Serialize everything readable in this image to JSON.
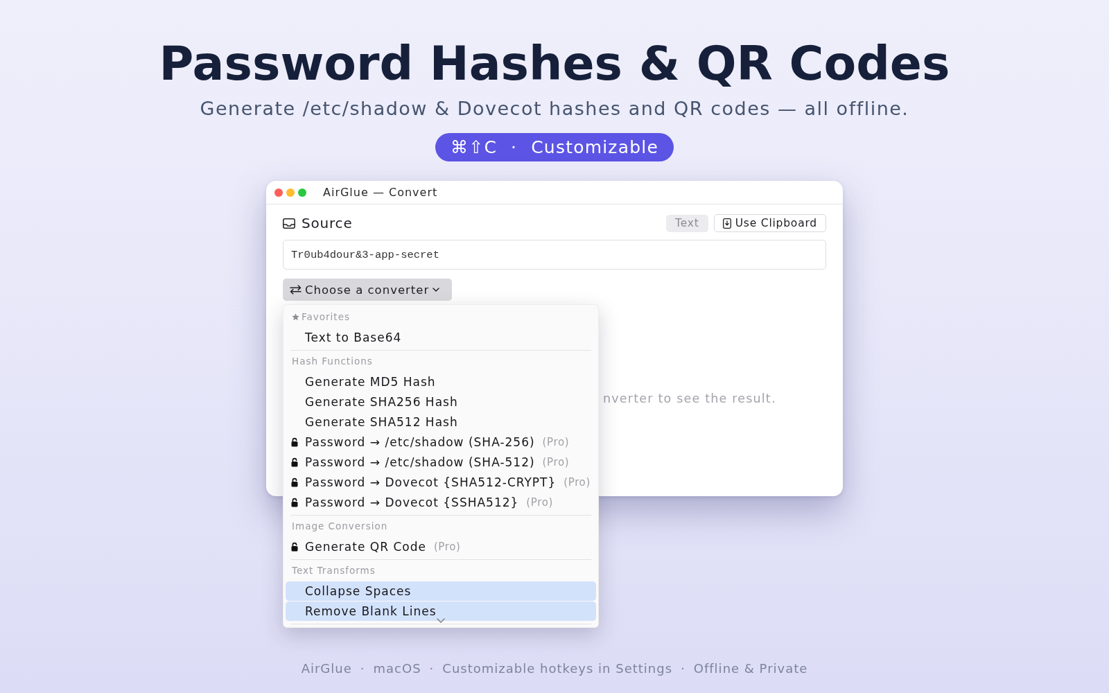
{
  "hero": {
    "title": "Password Hashes & QR Codes",
    "subtitle": "Generate /etc/shadow & Dovecot hashes and QR codes — all offline.",
    "badge": {
      "keys": "⌘⇧C",
      "separator": "·",
      "label": "Customizable"
    }
  },
  "window": {
    "title": "AirGlue — Convert"
  },
  "source": {
    "title": "Source",
    "type_tag": "Text",
    "clipboard_button": "Use Clipboard",
    "input_value": "Tr0ub4dour&3-app-secret"
  },
  "converter_button": {
    "label": "Choose a converter",
    "expanded": true
  },
  "empty_result_message": "nverter to see the result.",
  "menu": {
    "more_below": true,
    "sections": [
      {
        "kind": "favorites",
        "title": "Favorites",
        "items": [
          {
            "label": "Text to Base64",
            "locked": false,
            "selected": false
          }
        ]
      },
      {
        "kind": "plain",
        "title": "Hash Functions",
        "items": [
          {
            "label": "Generate MD5 Hash",
            "locked": false,
            "selected": false
          },
          {
            "label": "Generate SHA256 Hash",
            "locked": false,
            "selected": false
          },
          {
            "label": "Generate SHA512 Hash",
            "locked": false,
            "selected": false
          },
          {
            "label": "Password → /etc/shadow (SHA-256)",
            "locked": true,
            "badge": "(Pro)",
            "selected": false
          },
          {
            "label": "Password → /etc/shadow (SHA-512)",
            "locked": true,
            "badge": "(Pro)",
            "selected": false
          },
          {
            "label": "Password → Dovecot {SHA512-CRYPT}",
            "locked": true,
            "badge": "(Pro)",
            "selected": false
          },
          {
            "label": "Password → Dovecot {SSHA512}",
            "locked": true,
            "badge": "(Pro)",
            "selected": false
          }
        ]
      },
      {
        "kind": "plain",
        "title": "Image Conversion",
        "items": [
          {
            "label": "Generate QR Code",
            "locked": true,
            "badge": "(Pro)",
            "selected": false
          }
        ]
      },
      {
        "kind": "plain",
        "title": "Text Transforms",
        "items": [
          {
            "label": "Collapse Spaces",
            "locked": false,
            "selected": true
          },
          {
            "label": "Remove Blank Lines",
            "locked": false,
            "selected": true
          }
        ]
      }
    ]
  },
  "footer": {
    "items": [
      "AirGlue",
      "macOS",
      "Customizable hotkeys in Settings",
      "Offline & Private"
    ],
    "separators": [
      "·",
      "·",
      "·"
    ]
  }
}
